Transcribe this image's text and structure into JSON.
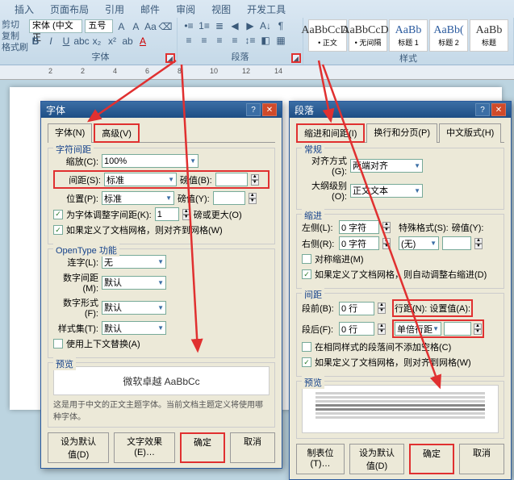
{
  "ribbon": {
    "tabs": [
      "插入",
      "页面布局",
      "引用",
      "邮件",
      "审阅",
      "视图",
      "开发工具"
    ],
    "clipboard": {
      "cut": "剪切",
      "copy": "复制",
      "fmt": "格式刷"
    },
    "font": {
      "name": "宋体 (中文正",
      "size": "五号",
      "label": "字体"
    },
    "para": {
      "label": "段落"
    },
    "styles": {
      "label": "样式",
      "items": [
        {
          "sample": "AaBbCcDd",
          "name": "• 正文"
        },
        {
          "sample": "AaBbCcDd",
          "name": "• 无间隔"
        },
        {
          "sample": "AaBb",
          "name": "标题 1"
        },
        {
          "sample": "AaBb(",
          "name": "标题 2"
        },
        {
          "sample": "AaBb",
          "name": "标题"
        }
      ]
    }
  },
  "fontDlg": {
    "title": "字体",
    "tabs": {
      "font": "字体(N)",
      "adv": "高级(V)"
    },
    "charSpacing": {
      "title": "字符间距",
      "scale": "缩放(C):",
      "scale_val": "100%",
      "spacing": "间距(S):",
      "spacing_val": "标准",
      "pt": "磅值(B):",
      "pos": "位置(P):",
      "pos_val": "标准",
      "pt2": "磅值(Y):",
      "kern": "为字体调整字间距(K):",
      "kern_val": "1",
      "kern_unit": "磅或更大(O)",
      "snap": "如果定义了文档网格，则对齐到网格(W)"
    },
    "opentype": {
      "title": "OpenType 功能",
      "lig": "连字(L):",
      "lig_val": "无",
      "numsp": "数字间距(M):",
      "numsp_val": "默认",
      "numfm": "数字形式(F):",
      "numfm_val": "默认",
      "styset": "样式集(T):",
      "styset_val": "默认",
      "ctx": "使用上下文替换(A)"
    },
    "preview": {
      "title": "预览",
      "text": "微软卓越 AaBbCc",
      "note": "这是用于中文的正文主题字体。当前文档主题定义将使用哪种字体。"
    },
    "buttons": {
      "default": "设为默认值(D)",
      "textfx": "文字效果(E)…",
      "ok": "确定",
      "cancel": "取消"
    }
  },
  "paraDlg": {
    "title": "段落",
    "tabs": {
      "indent": "缩进和间距(I)",
      "line": "换行和分页(P)",
      "cjk": "中文版式(H)"
    },
    "general": {
      "title": "常规",
      "align": "对齐方式(G):",
      "align_val": "两端对齐",
      "outline": "大纲级别(O):",
      "outline_val": "正文文本"
    },
    "indent": {
      "title": "缩进",
      "left": "左侧(L):",
      "left_val": "0 字符",
      "right": "右侧(R):",
      "right_val": "0 字符",
      "special": "特殊格式(S):",
      "special_val": "(无)",
      "by": "磅值(Y):",
      "mirror": "对称缩进(M)",
      "auto": "如果定义了文档网格，则自动调整右缩进(D)"
    },
    "spacing": {
      "title": "间距",
      "before": "段前(B):",
      "before_val": "0 行",
      "after": "段后(F):",
      "after_val": "0 行",
      "line": "行距(N):",
      "line_val": "单倍行距",
      "at": "设置值(A):",
      "nosame": "在相同样式的段落间不添加空格(C)",
      "snap": "如果定义了文档网格，则对齐到网格(W)"
    },
    "preview": {
      "title": "预览"
    },
    "buttons": {
      "tabs": "制表位(T)…",
      "default": "设为默认值(D)",
      "ok": "确定",
      "cancel": "取消"
    }
  }
}
